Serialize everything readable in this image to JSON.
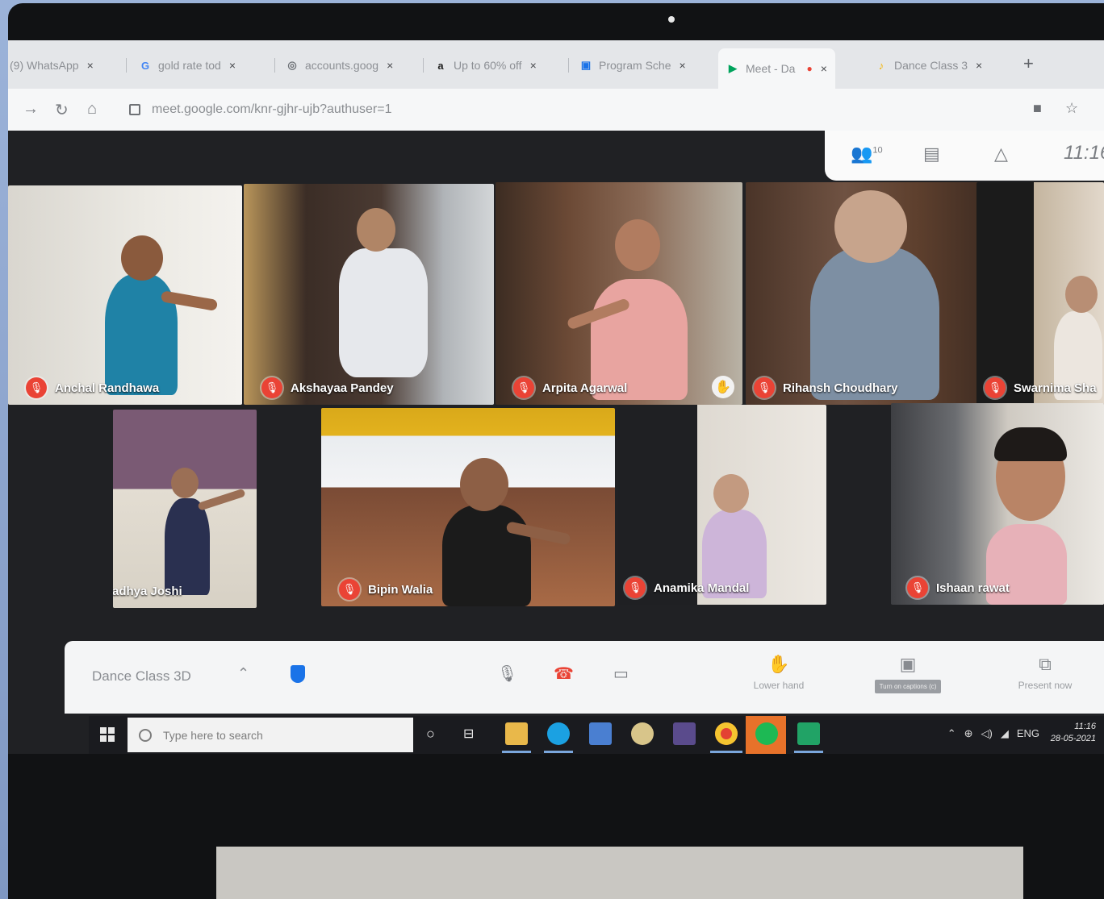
{
  "browser": {
    "tabs": [
      {
        "icon": "whatsapp-icon",
        "label": "(9) WhatsApp"
      },
      {
        "icon": "google-icon",
        "glyph": "G",
        "label": "gold rate tod"
      },
      {
        "icon": "globe-icon",
        "glyph": "◎",
        "label": "accounts.goog"
      },
      {
        "icon": "amazon-icon",
        "glyph": "a",
        "label": "Up to 60% off"
      },
      {
        "icon": "calendar-icon",
        "glyph": "▣",
        "label": "Program Sche"
      },
      {
        "icon": "meet-icon",
        "glyph": "▶",
        "label": "Meet - Da"
      },
      {
        "icon": "dance-icon",
        "glyph": "♪",
        "label": "Dance Class 3"
      }
    ],
    "close_glyph": "×",
    "new_tab_glyph": "+",
    "url": "meet.google.com/knr-gjhr-ujb?authuser=1"
  },
  "meet": {
    "people_count": "10",
    "time": "11:16",
    "participants_row1": [
      {
        "name": "Anchal Randhawa",
        "bg": "#e9e7e2",
        "shirt": "#1f82a6"
      },
      {
        "name": "Akshayaa Pandey",
        "bg": "#8a8c8e",
        "shirt": "#e6e8ec"
      },
      {
        "name": "Arpita Agarwal",
        "bg": "#6c4a36",
        "shirt": "#e8a4a0"
      },
      {
        "name": "Rihansh Choudhary",
        "bg": "#5d3f2d",
        "shirt": "#7d8fa3"
      },
      {
        "name": "Swarnima Sha",
        "bg": "#c4b59f",
        "shirt": "#ece6df"
      }
    ],
    "participants_row2": [
      {
        "name": "Aaradhya Joshi",
        "bg": "#d7d1c5",
        "shirt": "#2a3050"
      },
      {
        "name": "Bipin Walia",
        "bg": "#a86a46",
        "shirt": "#1b1b1b"
      },
      {
        "name": "Anamika Mandal",
        "bg": "#d9d4cc",
        "shirt": "#cdb5d9"
      },
      {
        "name": "Ishaan rawat",
        "bg": "#cfcac2",
        "shirt": "#e7b1b8"
      }
    ],
    "bottom_bar": {
      "meeting_title": "Dance Class 3D",
      "lower_hand": "Lower hand",
      "captions": "Turn on captions (c)",
      "present_now": "Present now"
    }
  },
  "taskbar": {
    "search_placeholder": "Type here to search",
    "tray_lang": "ENG",
    "time": "11:16",
    "date": "28-05-2021"
  },
  "colors": {
    "mute_red": "#ea4335",
    "meet_dark": "#202124",
    "accent_blue": "#1a73e8"
  }
}
